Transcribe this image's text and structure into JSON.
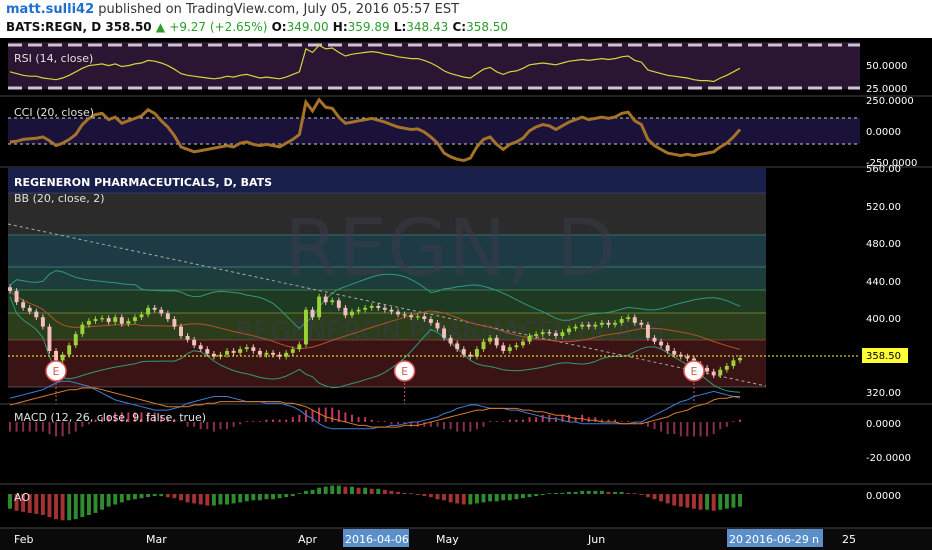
{
  "header": {
    "author": "matt.sulli42",
    "published_text": "published on TradingView.com, July 05, 2016 05:57 EST",
    "symbol": "BATS:REGN, D",
    "price": "358.50",
    "change_arrow": "▲",
    "change": "+9.27 (+2.65%)",
    "open_label": "O:",
    "open": "349.00",
    "high_label": "H:",
    "high": "359.89",
    "low_label": "L:",
    "low": "348.43",
    "close_label": "C:",
    "close": "358.50"
  },
  "panes": {
    "rsi": {
      "label": "RSI (14, close)",
      "ticks": [
        "50.0000",
        "25.0000"
      ]
    },
    "cci": {
      "label": "CCI (20, close)",
      "ticks": [
        "250.0000",
        "0.0000",
        "-250.0000"
      ]
    },
    "main": {
      "title": "REGENERON PHARMACEUTICALS, D, BATS",
      "bb_label": "BB (20, close, 2)",
      "watermark": "REGN, D",
      "watermark_sub": "REGENERON PHARMACEUTICALS",
      "ticks": [
        "560.00",
        "520.00",
        "480.00",
        "440.00",
        "400.00",
        "320.00"
      ],
      "last_price_tag": "358.50",
      "earnings_marker": "E"
    },
    "macd": {
      "label": "MACD (12, 26, close, 9, false, true)",
      "ticks": [
        "0.0000",
        "-20.0000"
      ]
    },
    "ao": {
      "label": "AO",
      "ticks": [
        "0.0000"
      ]
    }
  },
  "time_axis": {
    "labels": [
      "Feb",
      "Mar",
      "Apr",
      "May",
      "Jun",
      "25"
    ],
    "highlight_left": "2016-04-06",
    "highlight_right": "2016-06-29",
    "highlight_right_prefix": "20",
    "highlight_right_suffix": "n"
  },
  "colors": {
    "up": "#9ad23a",
    "down": "#f2c1bc",
    "rsi": "#d7d33c",
    "cci": "#a5722a",
    "macd": "#3f7fd6",
    "signal": "#e07b2a",
    "ao_up": "#2e8b2e",
    "ao_down": "#a33232",
    "price_tag": "#ffff33"
  },
  "chart_data": {
    "type": "candlestick",
    "symbol": "BATS:REGN",
    "interval": "D",
    "ylim": [
      320,
      560
    ],
    "closes": [
      430,
      418,
      412,
      408,
      402,
      392,
      366,
      356,
      362,
      372,
      384,
      394,
      398,
      400,
      401,
      397,
      402,
      395,
      398,
      402,
      405,
      412,
      410,
      406,
      400,
      392,
      382,
      378,
      372,
      368,
      363,
      360,
      362,
      366,
      364,
      368,
      370,
      366,
      362,
      364,
      362,
      360,
      364,
      368,
      373,
      410,
      402,
      424,
      418,
      420,
      412,
      404,
      408,
      410,
      412,
      414,
      412,
      410,
      408,
      405,
      404,
      402,
      403,
      400,
      396,
      390,
      380,
      374,
      368,
      362,
      360,
      368,
      376,
      380,
      372,
      366,
      370,
      372,
      376,
      382,
      384,
      386,
      385,
      382,
      386,
      390,
      392,
      394,
      392,
      394,
      396,
      394,
      396,
      400,
      402,
      396,
      394,
      380,
      376,
      372,
      366,
      362,
      360,
      358,
      352,
      348,
      344,
      340,
      346,
      350,
      356,
      358.5
    ],
    "rsi": [
      40,
      38,
      36,
      35,
      35,
      33,
      32,
      31,
      33,
      36,
      40,
      44,
      47,
      48,
      49,
      47,
      49,
      46,
      47,
      49,
      50,
      53,
      52,
      50,
      47,
      43,
      38,
      36,
      35,
      34,
      33,
      32,
      33,
      35,
      34,
      36,
      37,
      35,
      33,
      34,
      33,
      32,
      34,
      37,
      40,
      66,
      62,
      70,
      66,
      67,
      62,
      58,
      60,
      61,
      62,
      63,
      62,
      60,
      59,
      57,
      56,
      55,
      55,
      53,
      50,
      46,
      41,
      38,
      36,
      34,
      33,
      38,
      43,
      45,
      40,
      37,
      40,
      41,
      44,
      48,
      49,
      50,
      49,
      48,
      50,
      52,
      53,
      54,
      53,
      54,
      55,
      54,
      55,
      57,
      58,
      53,
      51,
      42,
      40,
      38,
      36,
      35,
      34,
      33,
      31,
      30,
      30,
      29,
      33,
      36,
      40,
      44
    ],
    "cci": [
      -80,
      -75,
      -60,
      -55,
      -50,
      -40,
      -70,
      -110,
      -90,
      -60,
      -20,
      60,
      110,
      140,
      150,
      100,
      120,
      70,
      90,
      110,
      130,
      180,
      150,
      90,
      40,
      -30,
      -120,
      -140,
      -160,
      -150,
      -140,
      -130,
      -120,
      -110,
      -120,
      -90,
      -80,
      -100,
      -110,
      -100,
      -110,
      -120,
      -90,
      -60,
      -20,
      240,
      170,
      260,
      200,
      190,
      120,
      70,
      80,
      90,
      100,
      110,
      95,
      80,
      60,
      40,
      30,
      20,
      25,
      0,
      -40,
      -90,
      -170,
      -200,
      -220,
      -230,
      -210,
      -120,
      -60,
      -40,
      -100,
      -140,
      -100,
      -80,
      -50,
      10,
      40,
      60,
      50,
      20,
      50,
      80,
      100,
      120,
      100,
      110,
      120,
      110,
      120,
      150,
      160,
      90,
      60,
      -60,
      -110,
      -140,
      -170,
      -180,
      -190,
      -180,
      -190,
      -180,
      -170,
      -160,
      -120,
      -90,
      -40,
      20
    ],
    "macd": [
      -14,
      -15,
      -16,
      -17,
      -18,
      -19,
      -21,
      -23,
      -24,
      -24,
      -23,
      -22,
      -21,
      -19,
      -17,
      -15,
      -13,
      -12,
      -11,
      -10,
      -9,
      -8,
      -7,
      -7,
      -7,
      -8,
      -9,
      -11,
      -12,
      -13,
      -14,
      -15,
      -15,
      -15,
      -14,
      -13,
      -12,
      -12,
      -12,
      -11,
      -11,
      -11,
      -10,
      -9,
      -7,
      -4,
      -2,
      1,
      3,
      4,
      4,
      4,
      4,
      4,
      4,
      4,
      3,
      3,
      2,
      2,
      1,
      0,
      0,
      -1,
      -2,
      -3,
      -5,
      -6,
      -8,
      -9,
      -10,
      -10,
      -9,
      -8,
      -8,
      -8,
      -7,
      -7,
      -6,
      -5,
      -4,
      -3,
      -2,
      -2,
      -1,
      0,
      0,
      1,
      1,
      1,
      1,
      1,
      1,
      1,
      1,
      0,
      0,
      -2,
      -4,
      -6,
      -8,
      -10,
      -12,
      -13,
      -15,
      -16,
      -17,
      -18,
      -17,
      -16,
      -15,
      -14
    ],
    "signal": [
      -10,
      -11,
      -12,
      -13,
      -14,
      -15,
      -16,
      -17,
      -18,
      -19,
      -19,
      -20,
      -20,
      -20,
      -19,
      -18,
      -17,
      -16,
      -15,
      -14,
      -13,
      -12,
      -11,
      -10,
      -9,
      -9,
      -9,
      -9,
      -10,
      -10,
      -11,
      -11,
      -12,
      -12,
      -12,
      -12,
      -12,
      -12,
      -12,
      -12,
      -12,
      -12,
      -11,
      -11,
      -10,
      -9,
      -7,
      -5,
      -3,
      -2,
      -1,
      0,
      1,
      2,
      2,
      3,
      3,
      3,
      3,
      3,
      2,
      2,
      2,
      1,
      0,
      -1,
      -2,
      -3,
      -4,
      -5,
      -6,
      -7,
      -7,
      -8,
      -8,
      -8,
      -8,
      -8,
      -7,
      -7,
      -6,
      -6,
      -5,
      -4,
      -4,
      -3,
      -2,
      -2,
      -1,
      -1,
      0,
      0,
      0,
      1,
      1,
      1,
      1,
      0,
      -1,
      -2,
      -3,
      -5,
      -6,
      -7,
      -9,
      -10,
      -11,
      -13,
      -14,
      -14,
      -15,
      -15
    ],
    "ao": [
      -14,
      -16,
      -17,
      -18,
      -19,
      -20,
      -22,
      -24,
      -25,
      -25,
      -24,
      -22,
      -20,
      -18,
      -15,
      -12,
      -10,
      -8,
      -6,
      -5,
      -4,
      -3,
      -2,
      -2,
      -3,
      -4,
      -6,
      -8,
      -9,
      -10,
      -11,
      -11,
      -10,
      -10,
      -9,
      -8,
      -7,
      -6,
      -6,
      -5,
      -5,
      -4,
      -3,
      -2,
      0,
      3,
      4,
      6,
      7,
      8,
      8,
      7,
      7,
      6,
      6,
      5,
      5,
      4,
      3,
      2,
      1,
      0,
      -1,
      -2,
      -3,
      -5,
      -6,
      -8,
      -9,
      -10,
      -10,
      -9,
      -8,
      -7,
      -7,
      -6,
      -6,
      -5,
      -4,
      -3,
      -2,
      -1,
      0,
      1,
      1,
      2,
      2,
      3,
      3,
      3,
      3,
      2,
      2,
      2,
      1,
      0,
      -1,
      -3,
      -5,
      -7,
      -9,
      -11,
      -12,
      -13,
      -14,
      -15,
      -15,
      -16,
      -15,
      -14,
      -13,
      -12
    ],
    "earnings_events_index": [
      7,
      60,
      104
    ]
  }
}
